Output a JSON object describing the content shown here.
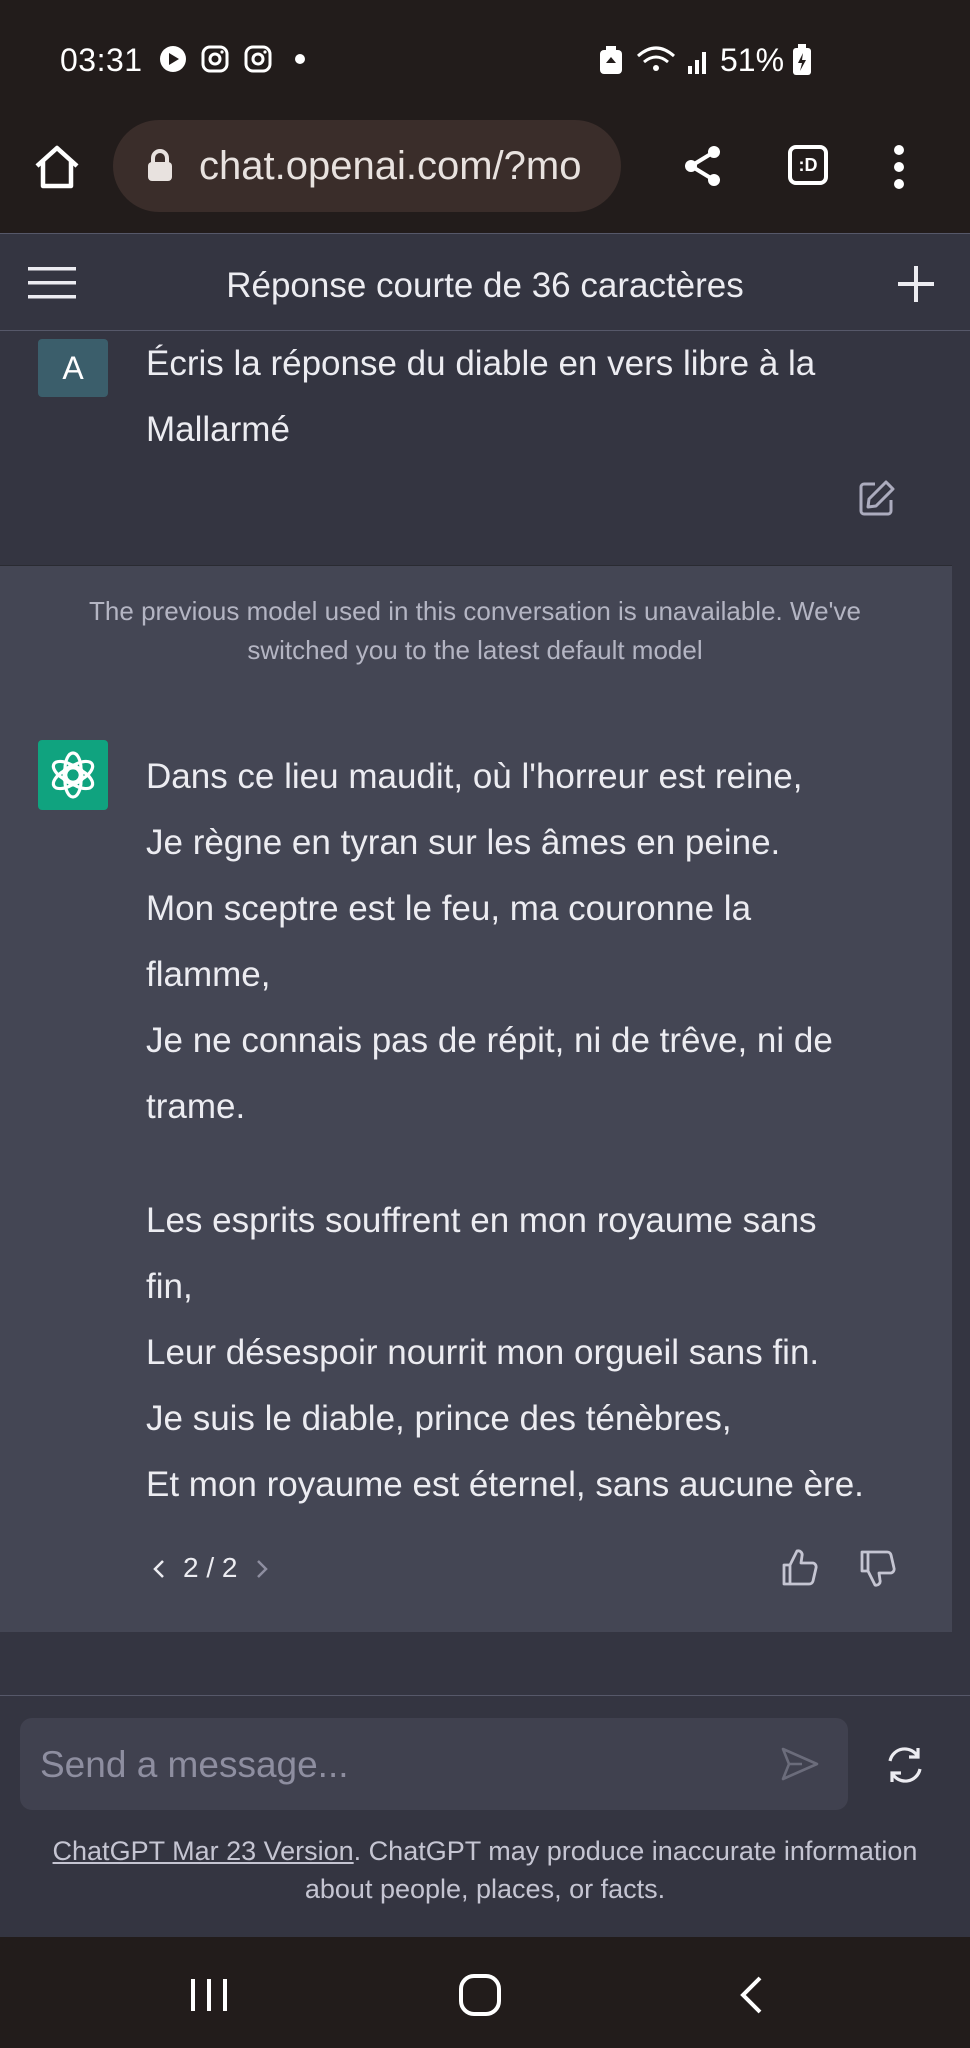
{
  "status_bar": {
    "time": "03:31",
    "battery": "51%"
  },
  "browser": {
    "url": "chat.openai.com/?mo",
    "tab_icon_label": ":D"
  },
  "chat": {
    "title": "Réponse courte de 36 caractères",
    "user": {
      "avatar_letter": "A",
      "message": "Écris la réponse du diable en vers libre à la Mallarmé"
    },
    "notice": "The previous model used in this conversation is unavailable. We've switched you to the latest default model",
    "assistant": {
      "stanza1": [
        "Dans ce lieu maudit, où l'horreur est reine,",
        "Je règne en tyran sur les âmes en peine.",
        "Mon sceptre est le feu, ma couronne la",
        "flamme,",
        "Je ne connais pas de répit, ni de trêve, ni de",
        "trame."
      ],
      "stanza2": [
        "Les esprits souffrent en mon royaume sans",
        "fin,",
        "Leur désespoir nourrit mon orgueil sans fin.",
        "Je suis le diable, prince des ténèbres,",
        "Et mon royaume est éternel, sans aucune ère."
      ],
      "pager": "2 / 2"
    }
  },
  "composer": {
    "placeholder": "Send a message...",
    "footer_link": "ChatGPT Mar 23 Version",
    "footer_text": ". ChatGPT may produce inaccurate information about people, places, or facts."
  },
  "colors": {
    "page_bg": "#343541",
    "message_bg": "#444654",
    "accent": "#10a37f",
    "system_bar": "#221c1b"
  }
}
